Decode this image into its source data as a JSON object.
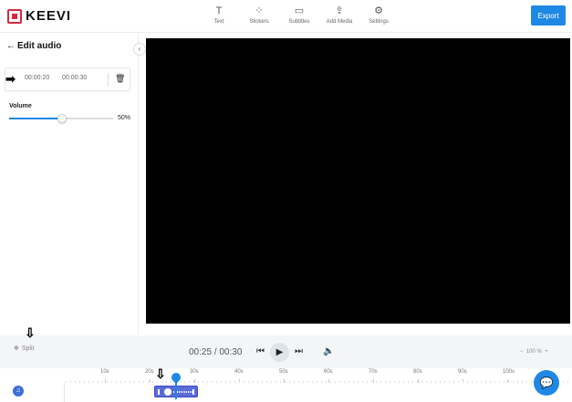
{
  "app": {
    "logo_text": "KEEVI"
  },
  "toolbar": {
    "items": [
      {
        "label": "Text",
        "icon": "text-icon"
      },
      {
        "label": "Stickers",
        "icon": "stickers-icon"
      },
      {
        "label": "Subtitles",
        "icon": "subtitles-icon"
      },
      {
        "label": "Add Media",
        "icon": "upload-icon"
      },
      {
        "label": "Settings",
        "icon": "gear-icon"
      }
    ],
    "export_label": "Export"
  },
  "panel": {
    "title": "Edit audio",
    "start_time": "00:00:20",
    "end_time": "00:00:30",
    "volume_label": "Volume",
    "volume_value": "50%",
    "volume_level": 0.5
  },
  "controls": {
    "split_label": "Split",
    "time_readout": "00:25 / 00:30",
    "zoom_label": "100 %"
  },
  "timeline": {
    "ticks": [
      "10s",
      "20s",
      "30s",
      "40s",
      "50s",
      "60s",
      "70s",
      "80s",
      "90s",
      "100s"
    ]
  },
  "colors": {
    "accent": "#1e88e5",
    "brand": "#d6283d",
    "clip": "#5b6bd6"
  }
}
